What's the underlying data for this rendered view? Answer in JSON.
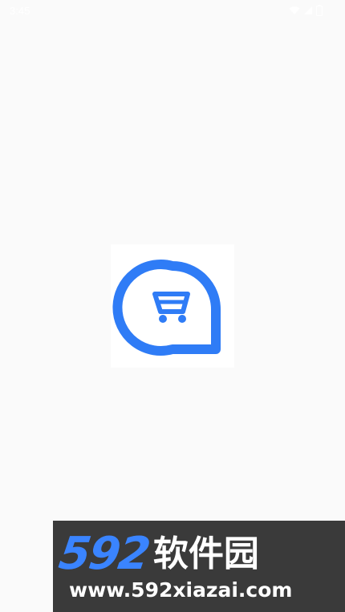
{
  "status_bar": {
    "time": "3:45",
    "icons": [
      "wifi-icon",
      "cellular-signal-icon",
      "battery-icon"
    ]
  },
  "splash": {
    "logo_icon": "shopping-cart-chat-bubble-icon",
    "logo_color": "#2f7cf6"
  },
  "watermark": {
    "number": "592",
    "chinese": "软件园",
    "url": "www.592xiazai.com",
    "number_color": "#3a84ff",
    "background": "#3a3a3a"
  }
}
